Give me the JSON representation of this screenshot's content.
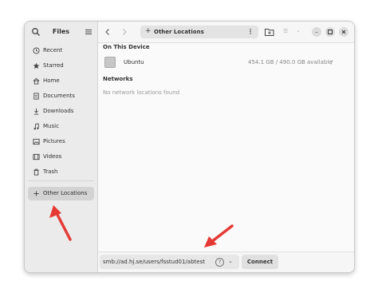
{
  "sidebar": {
    "title": "Files",
    "items": [
      {
        "label": "Recent",
        "icon": "clock-icon"
      },
      {
        "label": "Starred",
        "icon": "star-icon"
      },
      {
        "label": "Home",
        "icon": "home-icon"
      },
      {
        "label": "Documents",
        "icon": "document-icon"
      },
      {
        "label": "Downloads",
        "icon": "download-icon"
      },
      {
        "label": "Music",
        "icon": "music-icon"
      },
      {
        "label": "Pictures",
        "icon": "picture-icon"
      },
      {
        "label": "Videos",
        "icon": "video-icon"
      },
      {
        "label": "Trash",
        "icon": "trash-icon"
      }
    ],
    "other_locations": "Other Locations"
  },
  "header": {
    "path": "Other Locations"
  },
  "content": {
    "on_device_heading": "On This Device",
    "device": {
      "name": "Ubuntu",
      "usage": "454.1 GB / 490.0 GB available",
      "mount": "/"
    },
    "networks_heading": "Networks",
    "networks_empty": "No network locations found"
  },
  "bottom": {
    "address": "smb://ad.hj.se/users/fsstud01/abtest",
    "connect_label": "Connect"
  },
  "colors": {
    "annotation_arrow": "#e53935"
  }
}
